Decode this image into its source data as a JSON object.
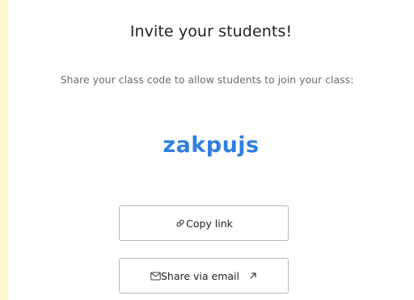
{
  "invite": {
    "title": "Invite your students!",
    "subtitle": "Share your class code to allow students to join your class:",
    "class_code": "zakpujs",
    "copy_link_label": "Copy link",
    "share_email_label": "Share via email"
  },
  "colors": {
    "background": "#fbf8cf",
    "card": "#ffffff",
    "code_accent": "#2f7fdf",
    "button_border": "#b9b9b9"
  },
  "icons": {
    "copy_link": "link-icon",
    "share_email": "envelope-icon",
    "external": "external-link-arrow-icon"
  }
}
